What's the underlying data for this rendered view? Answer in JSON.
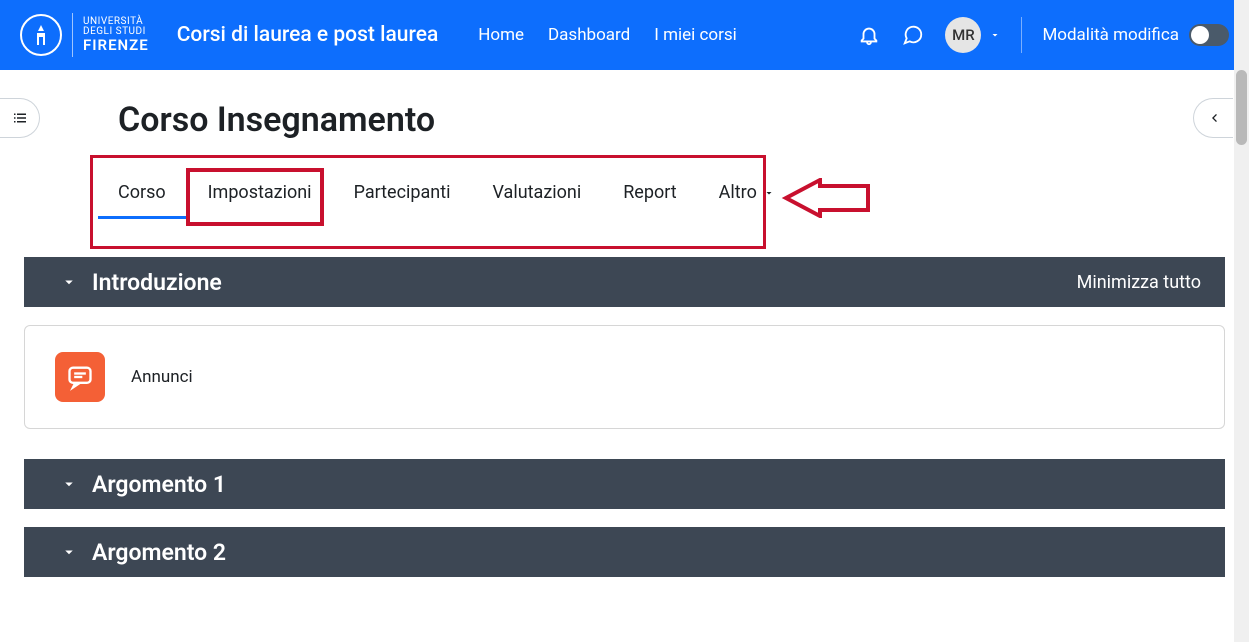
{
  "brand": {
    "uni_line1": "UNIVERSITÀ",
    "uni_line2": "DEGLI STUDI",
    "uni_line3": "FIRENZE"
  },
  "site_title": "Corsi di laurea e post laurea",
  "nav": {
    "home": "Home",
    "dashboard": "Dashboard",
    "mycourses": "I miei corsi"
  },
  "user": {
    "initials": "MR"
  },
  "edit_mode_label": "Modalità modifica",
  "page_title": "Corso Insegnamento",
  "tabs": {
    "course": "Corso",
    "settings": "Impostazioni",
    "participants": "Partecipanti",
    "grades": "Valutazioni",
    "report": "Report",
    "more": "Altro"
  },
  "minimize_all": "Minimizza tutto",
  "sections": {
    "intro": "Introduzione",
    "arg1": "Argomento 1",
    "arg2": "Argomento 2"
  },
  "activities": {
    "announcements": "Annunci"
  },
  "colors": {
    "primary": "#0d6efd",
    "section_bg": "#3d4754",
    "highlight": "#c8102e",
    "activity_icon": "#f46036"
  }
}
